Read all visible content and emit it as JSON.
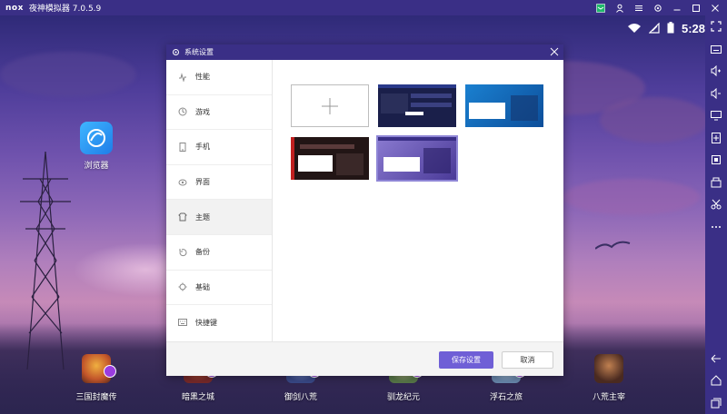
{
  "window": {
    "logo": "nox",
    "title": "夜神模拟器 7.0.5.9"
  },
  "status": {
    "clock": "5:28"
  },
  "desktop": {
    "apps": [
      {
        "label": "浏览器",
        "icon": "browser-icon"
      }
    ]
  },
  "dock": {
    "apps": [
      {
        "label": "三国封魔传",
        "color": "#c2552a"
      },
      {
        "label": "暗黑之城",
        "color": "#7a2a2a"
      },
      {
        "label": "御剑八荒",
        "color": "#3a4a8a"
      },
      {
        "label": "驯龙纪元",
        "color": "#5a7a4a"
      },
      {
        "label": "浮石之旅",
        "color": "#6a8ab0"
      },
      {
        "label": "八荒主宰",
        "color": "#4a2a20"
      }
    ]
  },
  "dialog": {
    "title": "系统设置",
    "nav": [
      {
        "label": "性能",
        "icon": "performance-icon"
      },
      {
        "label": "游戏",
        "icon": "game-icon"
      },
      {
        "label": "手机",
        "icon": "phone-icon"
      },
      {
        "label": "界面",
        "icon": "interface-icon"
      },
      {
        "label": "主题",
        "icon": "theme-icon",
        "active": true
      },
      {
        "label": "备份",
        "icon": "backup-icon"
      },
      {
        "label": "基础",
        "icon": "basic-icon"
      },
      {
        "label": "快捷键",
        "icon": "shortcut-icon"
      }
    ],
    "themes": [
      {
        "name": "add",
        "bg": "#ffffff"
      },
      {
        "name": "dark-blue",
        "bg": "#1a1f4a"
      },
      {
        "name": "ocean",
        "bg": "#1565b0"
      },
      {
        "name": "red-black",
        "bg": "#2a1a1a"
      },
      {
        "name": "purple",
        "bg": "#6a5ab8",
        "selected": true
      }
    ],
    "save_label": "保存设置",
    "cancel_label": "取消"
  },
  "colors": {
    "titlebar": "#3a2f86",
    "accent": "#6f5fd6"
  }
}
